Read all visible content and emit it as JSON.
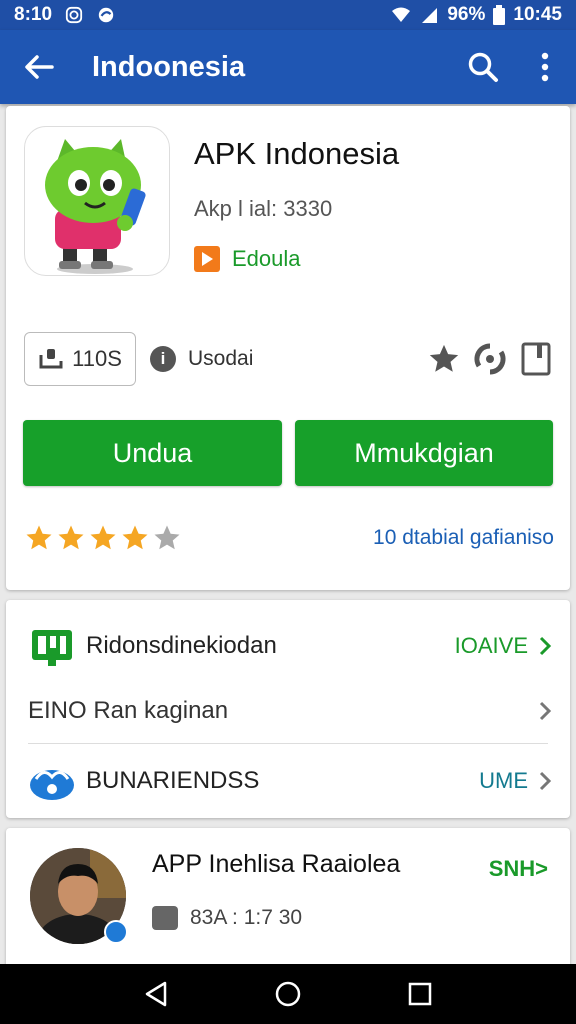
{
  "status_bar": {
    "time": "8:10",
    "battery": "96%",
    "clock_right": "10:45"
  },
  "toolbar": {
    "title": "Indoonesia"
  },
  "app": {
    "name": "APK Indonesia",
    "meta": "Akp l ial: 3330",
    "developer": "Edoula",
    "size_label": "110S",
    "info_label": "Usodai",
    "download_label": "Undua",
    "install_label": "Mmukdgian",
    "rating": 4,
    "rating_max": 5,
    "reviews_text": "10 dtabial gafianiso",
    "colors": {
      "accent_green": "#17a02a",
      "toolbar_blue": "#1f56b3",
      "star": "#f5a623"
    }
  },
  "sections": {
    "row1": {
      "label": "Ridonsdinekiodan",
      "action": "IOAIVE"
    },
    "row2": {
      "label": "EINO Ran kaginan"
    },
    "row3": {
      "label": "BUNARIENDSS",
      "action": "UME"
    }
  },
  "developer_card": {
    "name": "APP Inehlisa Raaiolea",
    "stat": "83A : 1:7 30",
    "action": "SNH>"
  },
  "icons": [
    "back-arrow-icon",
    "search-icon",
    "more-vert-icon",
    "star-icon",
    "share-icon",
    "bookmark-icon",
    "chevron-right-icon"
  ]
}
